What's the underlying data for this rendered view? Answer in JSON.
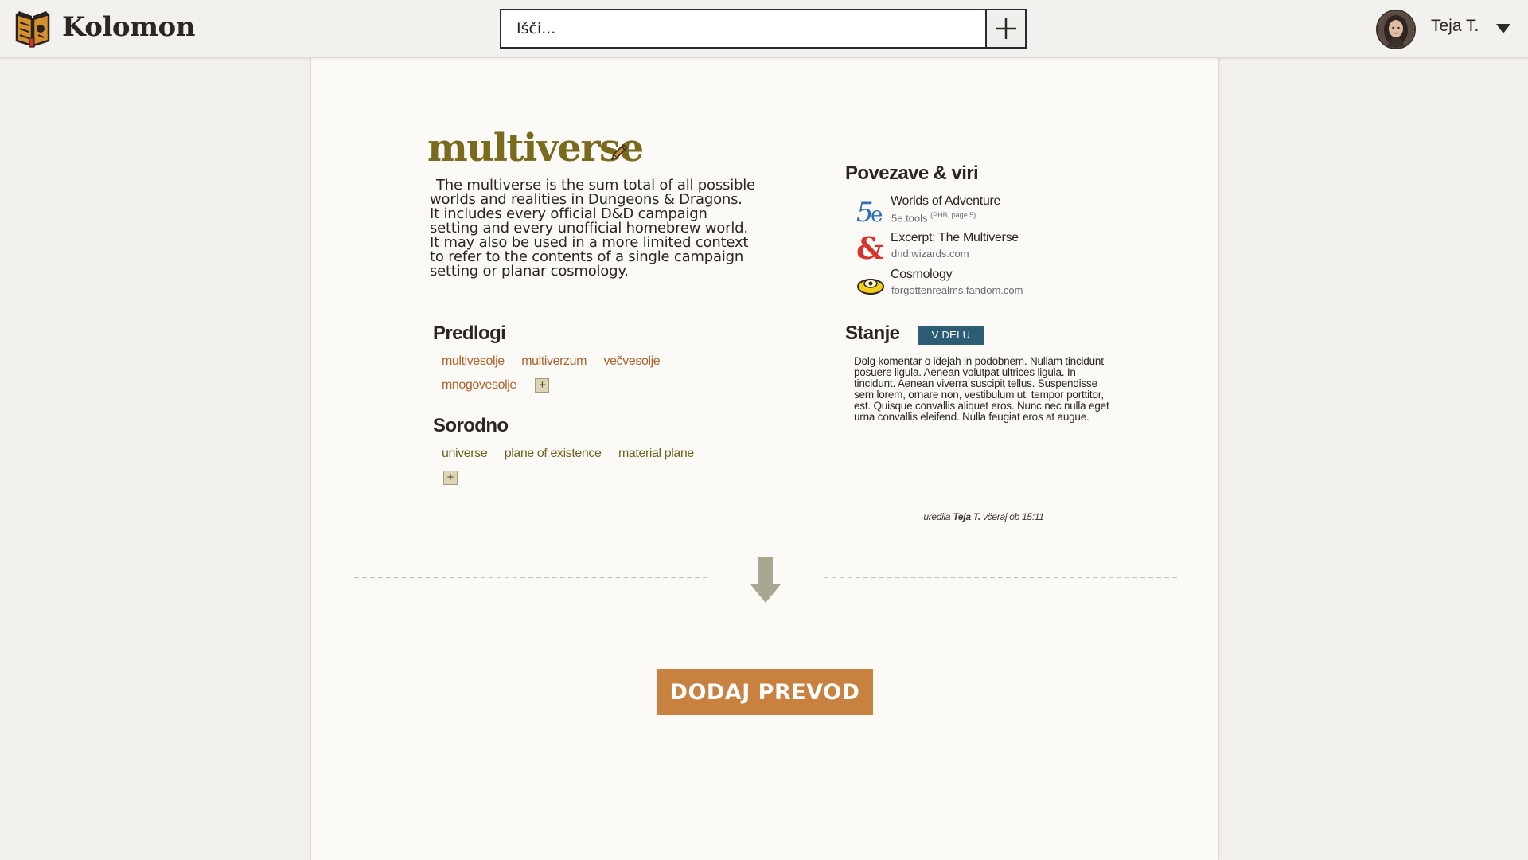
{
  "app": {
    "name": "Kolomon"
  },
  "search": {
    "placeholder": "Išči..."
  },
  "user": {
    "name": "Teja T."
  },
  "term": {
    "title": "multiverse",
    "description": "The multiverse is the sum total of all possible worlds and realities in Dungeons & Dragons. It includes every official D&D campaign setting and every unofficial homebrew world. It may also be used in a more limited context to refer to the contents of a single campaign setting or planar cosmology."
  },
  "suggestions": {
    "title": "Predlogi",
    "items": [
      "multivesolje",
      "multiverzum",
      "večvesolje",
      "mnogovesolje"
    ],
    "add_label": "+"
  },
  "related": {
    "title": "Sorodno",
    "items": [
      "universe",
      "plane of existence",
      "material plane"
    ],
    "add_label": "+"
  },
  "links": {
    "title": "Povezave & viri",
    "items": [
      {
        "title": "Worlds of Adventure",
        "source": "5e.tools",
        "note": "(PHB, page 5)",
        "icon": "5e-logo-icon"
      },
      {
        "title": "Excerpt: The Multiverse",
        "source": "dnd.wizards.com",
        "note": "",
        "icon": "ampersand-dnd-icon"
      },
      {
        "title": "Cosmology",
        "source": "forgottenrealms.fandom.com",
        "note": "",
        "icon": "fandom-eye-icon"
      }
    ]
  },
  "status": {
    "title": "Stanje",
    "badge": "V DELU",
    "badge_color": "#2d5d75",
    "comment": "Dolg komentar o idejah in podobnem. Nullam tincidunt posuere ligula. Aenean volutpat ultrices ligula. In tincidunt. Aenean viverra suscipit tellus. Suspendisse sem lorem, ornare non, vestibulum ut, tempor porttitor, est. Quisque convallis aliquet eros. Nunc nec nulla eget urna convallis eleifend. Nulla feugiat eros at augue."
  },
  "edited": {
    "prefix": "uredila",
    "user": "Teja T.",
    "when": "včeraj ob 15:11"
  },
  "cta": {
    "label": "DODAJ PREVOD",
    "color": "#c8813e"
  },
  "colors": {
    "title": "#7a6a1e",
    "suggestion": "#b0622a",
    "related": "#6f631f",
    "background": "#f3f1ee",
    "card": "#fbfaf7"
  }
}
